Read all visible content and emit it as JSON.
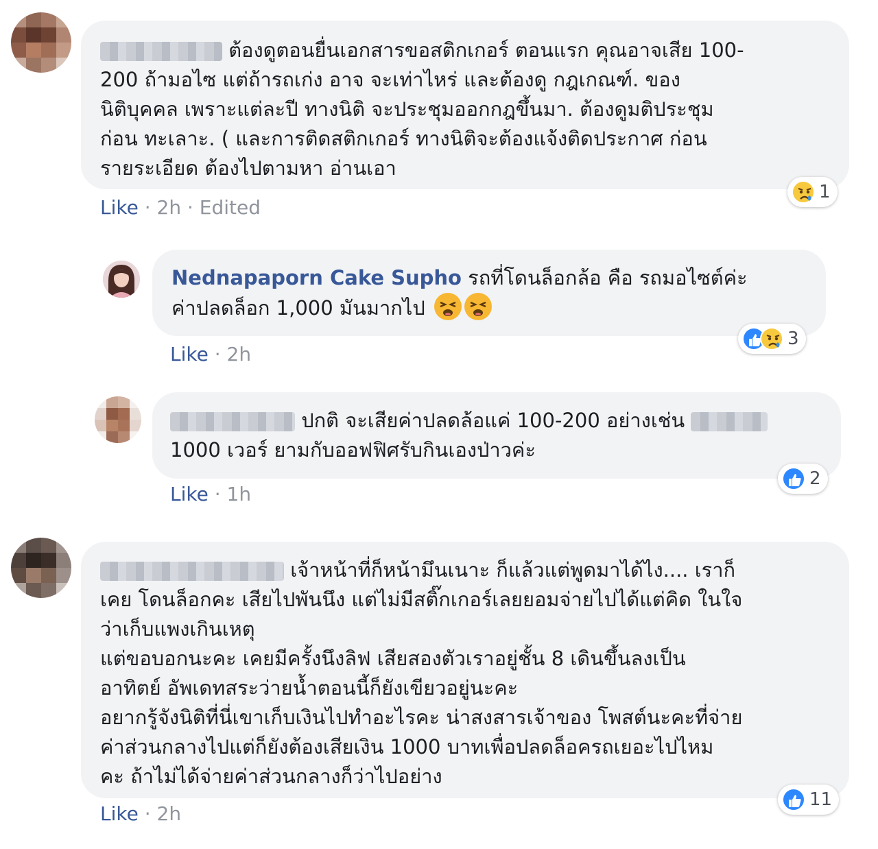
{
  "comments": [
    {
      "text": "ต้องดูตอนยื่นเอกสารขอสติกเกอร์ ตอนแรก คุณอาจเสีย 100-\n200 ถ้ามอไซ แต่ถ้ารถเก่ง อาจ จะเท่าไหร่ และต้องดู กฎเกณฑ์. ของ\nนิติบุคคล เพราะแต่ละปี ทางนิติ จะประชุมออกกฎขึ้นมา. ต้องดูมติประชุม\nก่อน ทะเลาะ. ( และการติดสติกเกอร์ ทางนิติจะต้องแจ้งติดประกาศ ก่อน\nรายระเอียด ต้องไปตามหา อ่านเอา",
      "like_label": "Like",
      "sep1": " · ",
      "time": "2h",
      "sep2": " · ",
      "edited": "Edited",
      "reaction_icon": "sad-icon",
      "reaction_count": "1"
    },
    {
      "name": "Nednapaporn Cake Supho",
      "text_line1": " รถที่โดนล็อกล้อ คือ รถมอไซต์ค่ะ",
      "text_line2": "ค่าปลดล็อก 1,000 มันมากไป",
      "emoji": "tired-face-emoji",
      "like_label": "Like",
      "sep1": " · ",
      "time": "2h",
      "reaction_icons": [
        "like-icon",
        "sad-icon"
      ],
      "reaction_count": "3"
    },
    {
      "text_line1": " ปกติ จะเสียค่าปลดล้อแค่ 100-200 อย่างเช่น ",
      "text_line2": "1000 เวอร์ ยามกับออฟฟิศรับกินเองป่าวค่ะ",
      "like_label": "Like",
      "sep1": " · ",
      "time": "1h",
      "reaction_icon": "like-icon",
      "reaction_count": "2"
    },
    {
      "text": " เจ้าหน้าที่ก็หน้ามึนเนาะ ก็แล้วแต่พูดมาได้ไง.... เราก็\nเคย โดนล็อกคะ เสียไปพันนึง แต่ไม่มีสติ๊กเกอร์เลยยอมจ่ายไปได้แต่คิด ในใจ\nว่าเก็บแพงเกินเหตุ\nแต่ขอบอกนะคะ เคยมีครั้งนึงลิฟ เสียสองตัวเราอยู่ชั้น 8 เดินขึ้นลงเป็น\nอาทิตย์ อัพเดทสระว่ายน้ำตอนนี้ก็ยังเขียวอยู่นะคะ\nอยากรู้จังนิติที่นี่เขาเก็บเงินไปทำอะไรคะ น่าสงสารเจ้าของ โพสต์นะคะที่จ่าย\nค่าส่วนกลางไปแต่ก็ยังต้องเสียเงิน 1000 บาทเพื่อปลดล็อครถเยอะไปไหม\nคะ ถ้าไม่ได้จ่ายค่าส่วนกลางก็ว่าไปอย่าง",
      "like_label": "Like",
      "sep1": " · ",
      "time": "2h",
      "reaction_icon": "like-icon",
      "reaction_count": "11"
    }
  ],
  "colors": {
    "link": "#385898",
    "bubble": "#f2f3f5",
    "meta": "#90949c",
    "like_blue": "#2d88ff",
    "sad_yellow": "#f7c93e"
  }
}
